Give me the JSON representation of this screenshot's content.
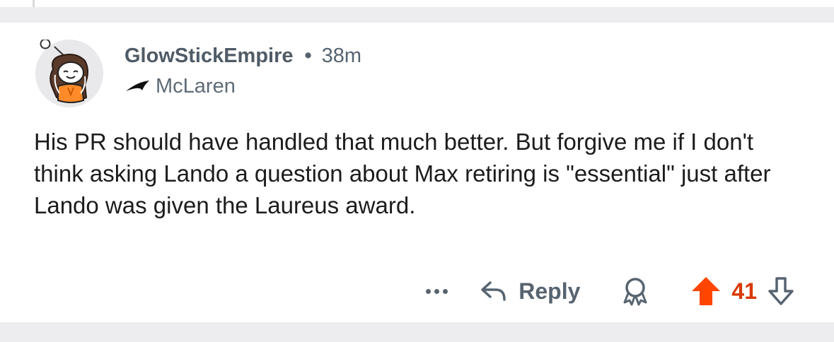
{
  "comment": {
    "author": "GlowStickEmpire",
    "separator": "•",
    "age": "38m",
    "flair": {
      "text": "McLaren",
      "icon": "mclaren-speedmark-icon"
    },
    "body": "His PR should have handled that much better. But forgive me if I don't think asking Lando a question about Max retiring is \"essential\" just after Lando was given the Laureus award.",
    "avatar_icon": "reddit-snoo-avatar"
  },
  "actions": {
    "more_icon": "more-dots-icon",
    "reply_label": "Reply",
    "reply_icon": "reply-arrow-icon",
    "award_icon": "award-icon",
    "upvote_icon": "upvote-arrow-icon",
    "score": "41",
    "downvote_icon": "downvote-arrow-icon"
  },
  "colors": {
    "upvote_active": "#ff4500",
    "score_active": "#d93a00",
    "muted_text": "#576470",
    "body_text": "#1c1c1c",
    "flair_icon": "#ff8000"
  }
}
